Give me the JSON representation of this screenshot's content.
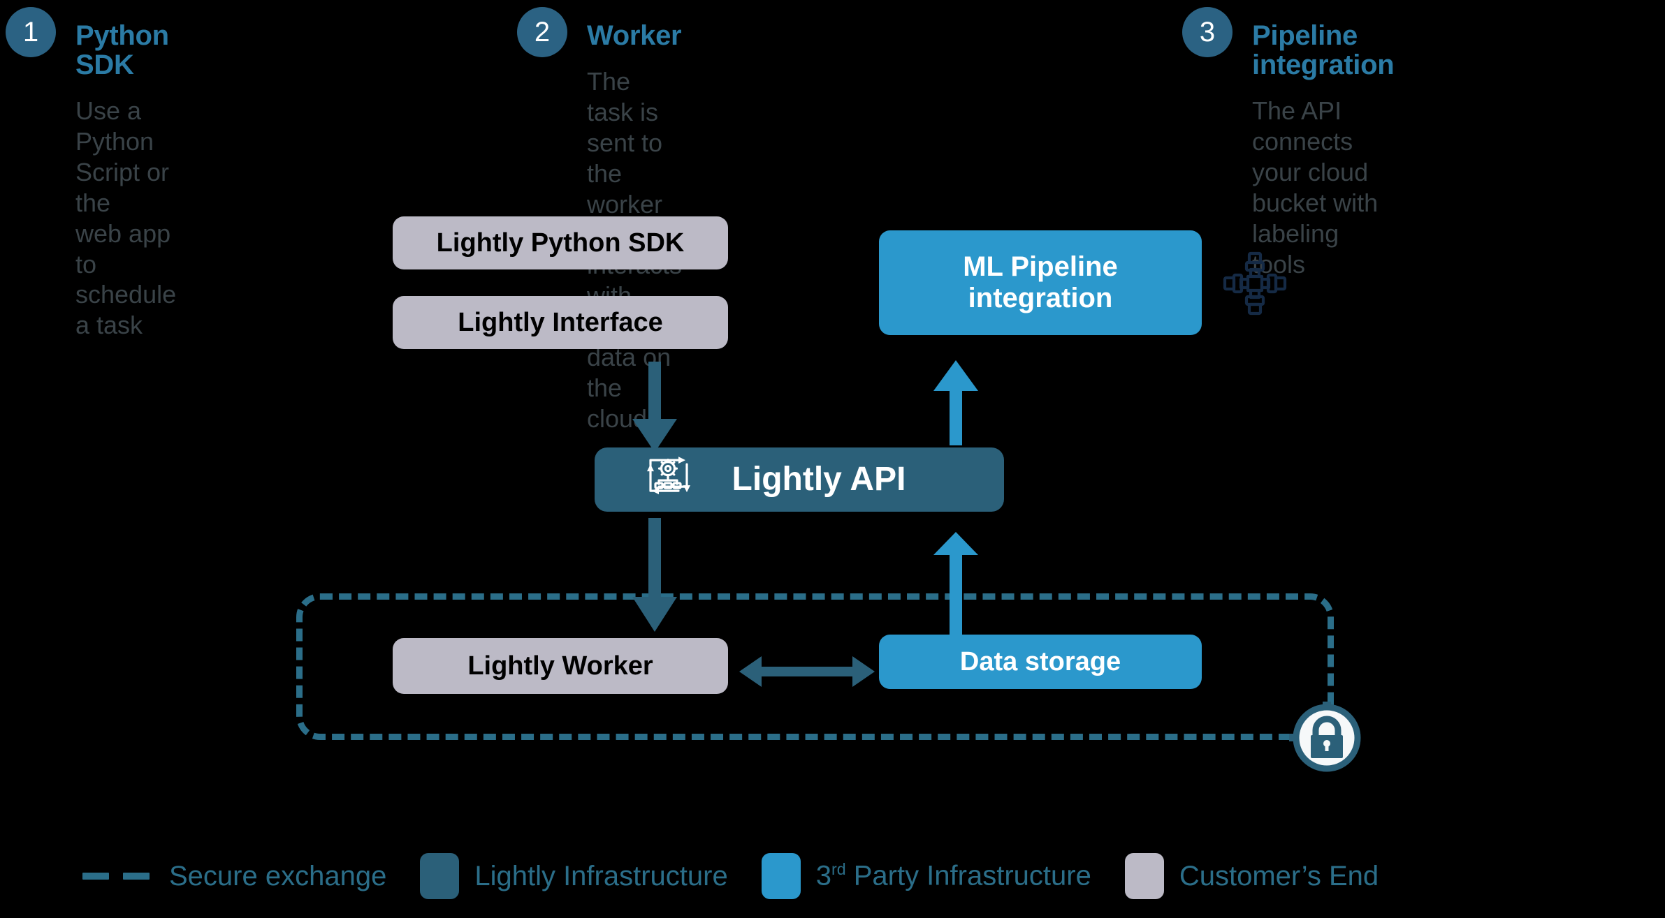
{
  "steps": [
    {
      "number": "1",
      "title": "Python SDK",
      "description": "Use a Python Script or the\nweb app to schedule a task"
    },
    {
      "number": "2",
      "title": "Worker",
      "description": "The task is sent to the worker which\ninteracts with your data on the cloud"
    },
    {
      "number": "3",
      "title": "Pipeline integration",
      "description": "The API connects your cloud\nbucket with labeling tools"
    }
  ],
  "diagram": {
    "boxes": {
      "python_sdk": "Lightly Python SDK",
      "interface": "Lightly Interface",
      "ml_pipeline": "ML Pipeline\nintegration",
      "api": "Lightly API",
      "worker": "Lightly Worker",
      "data_storage": "Data storage"
    },
    "icons": {
      "api": "gear-workflow-icon",
      "pipeline": "pipe-cross-icon",
      "lock": "lock-icon"
    },
    "arrows": [
      {
        "name": "sdk-to-api",
        "from": "Lightly Interface",
        "to": "Lightly API",
        "direction": "down",
        "color": "#2b6079"
      },
      {
        "name": "api-to-ml-pipeline",
        "from": "Lightly API",
        "to": "ML Pipeline integration",
        "direction": "up",
        "color": "#2b98cc"
      },
      {
        "name": "api-to-worker",
        "from": "Lightly API",
        "to": "Lightly Worker",
        "direction": "down",
        "color": "#2b6079"
      },
      {
        "name": "storage-to-api",
        "from": "Data storage",
        "to": "Lightly API",
        "direction": "up",
        "color": "#2b98cc"
      },
      {
        "name": "worker-storage",
        "from": "Lightly Worker",
        "to": "Data storage",
        "direction": "both",
        "color": "#2b6079"
      }
    ]
  },
  "legend": {
    "items": [
      {
        "type": "dashed-line",
        "label": "Secure exchange",
        "color": "#2b6e89"
      },
      {
        "type": "swatch",
        "label": "Lightly Infrastructure",
        "color": "#2b6079"
      },
      {
        "type": "swatch",
        "label": "3rd Party Infrastructure",
        "label_main": "3",
        "label_sup": "rd",
        "label_rest": " Party Infrastructure",
        "color": "#2b98cc"
      },
      {
        "type": "swatch",
        "label": "Customer’s End",
        "color": "#bcbac6"
      }
    ]
  },
  "colors": {
    "background": "#000000",
    "teal_dark": "#2b6079",
    "teal_mid": "#2b6e89",
    "blue": "#2b98cc",
    "gray": "#bcbac6",
    "title_blue": "#2b7ba5",
    "desc_gray": "#3a4348"
  }
}
